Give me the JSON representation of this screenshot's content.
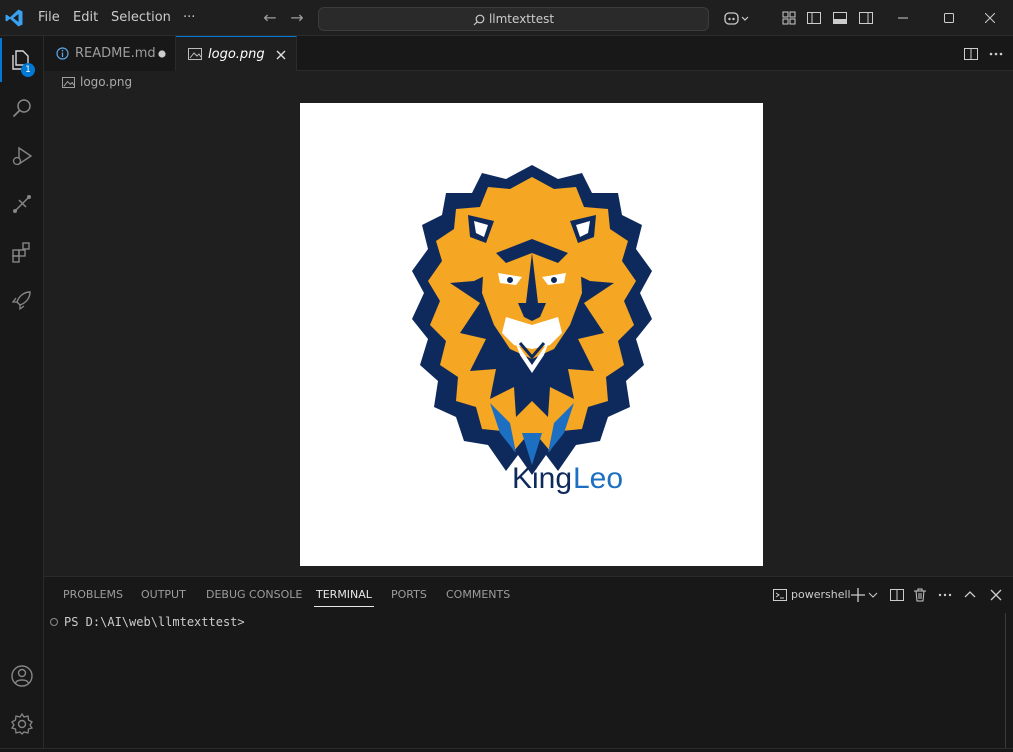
{
  "titlebar": {
    "menu": [
      "File",
      "Edit",
      "Selection",
      "···"
    ],
    "search_text": "llmtexttest",
    "accent_color": "#0078d4"
  },
  "activity_bar": {
    "explorer_badge": "1",
    "items": [
      "files-icon",
      "search-icon",
      "run-debug-icon",
      "source-control-icon",
      "extensions-icon",
      "rocket-icon",
      "account-icon",
      "gear-icon"
    ]
  },
  "tabs": [
    {
      "label": "README.md",
      "state": "modified",
      "icon": "info-icon"
    },
    {
      "label": "logo.png",
      "state": "active",
      "icon": "image-icon"
    }
  ],
  "breadcrumb": {
    "label": "logo.png"
  },
  "image": {
    "brand_king": "King",
    "brand_leo": "Leo",
    "brand_colors": {
      "navy": "#0e2a5c",
      "orange": "#f5a623",
      "blue": "#1d6fc1"
    }
  },
  "panel": {
    "tabs": [
      "PROBLEMS",
      "OUTPUT",
      "DEBUG CONSOLE",
      "TERMINAL",
      "PORTS",
      "COMMENTS"
    ],
    "active_tab": "TERMINAL",
    "shell": "powershell",
    "prompt": "PS D:\\AI\\web\\llmtexttest>"
  }
}
